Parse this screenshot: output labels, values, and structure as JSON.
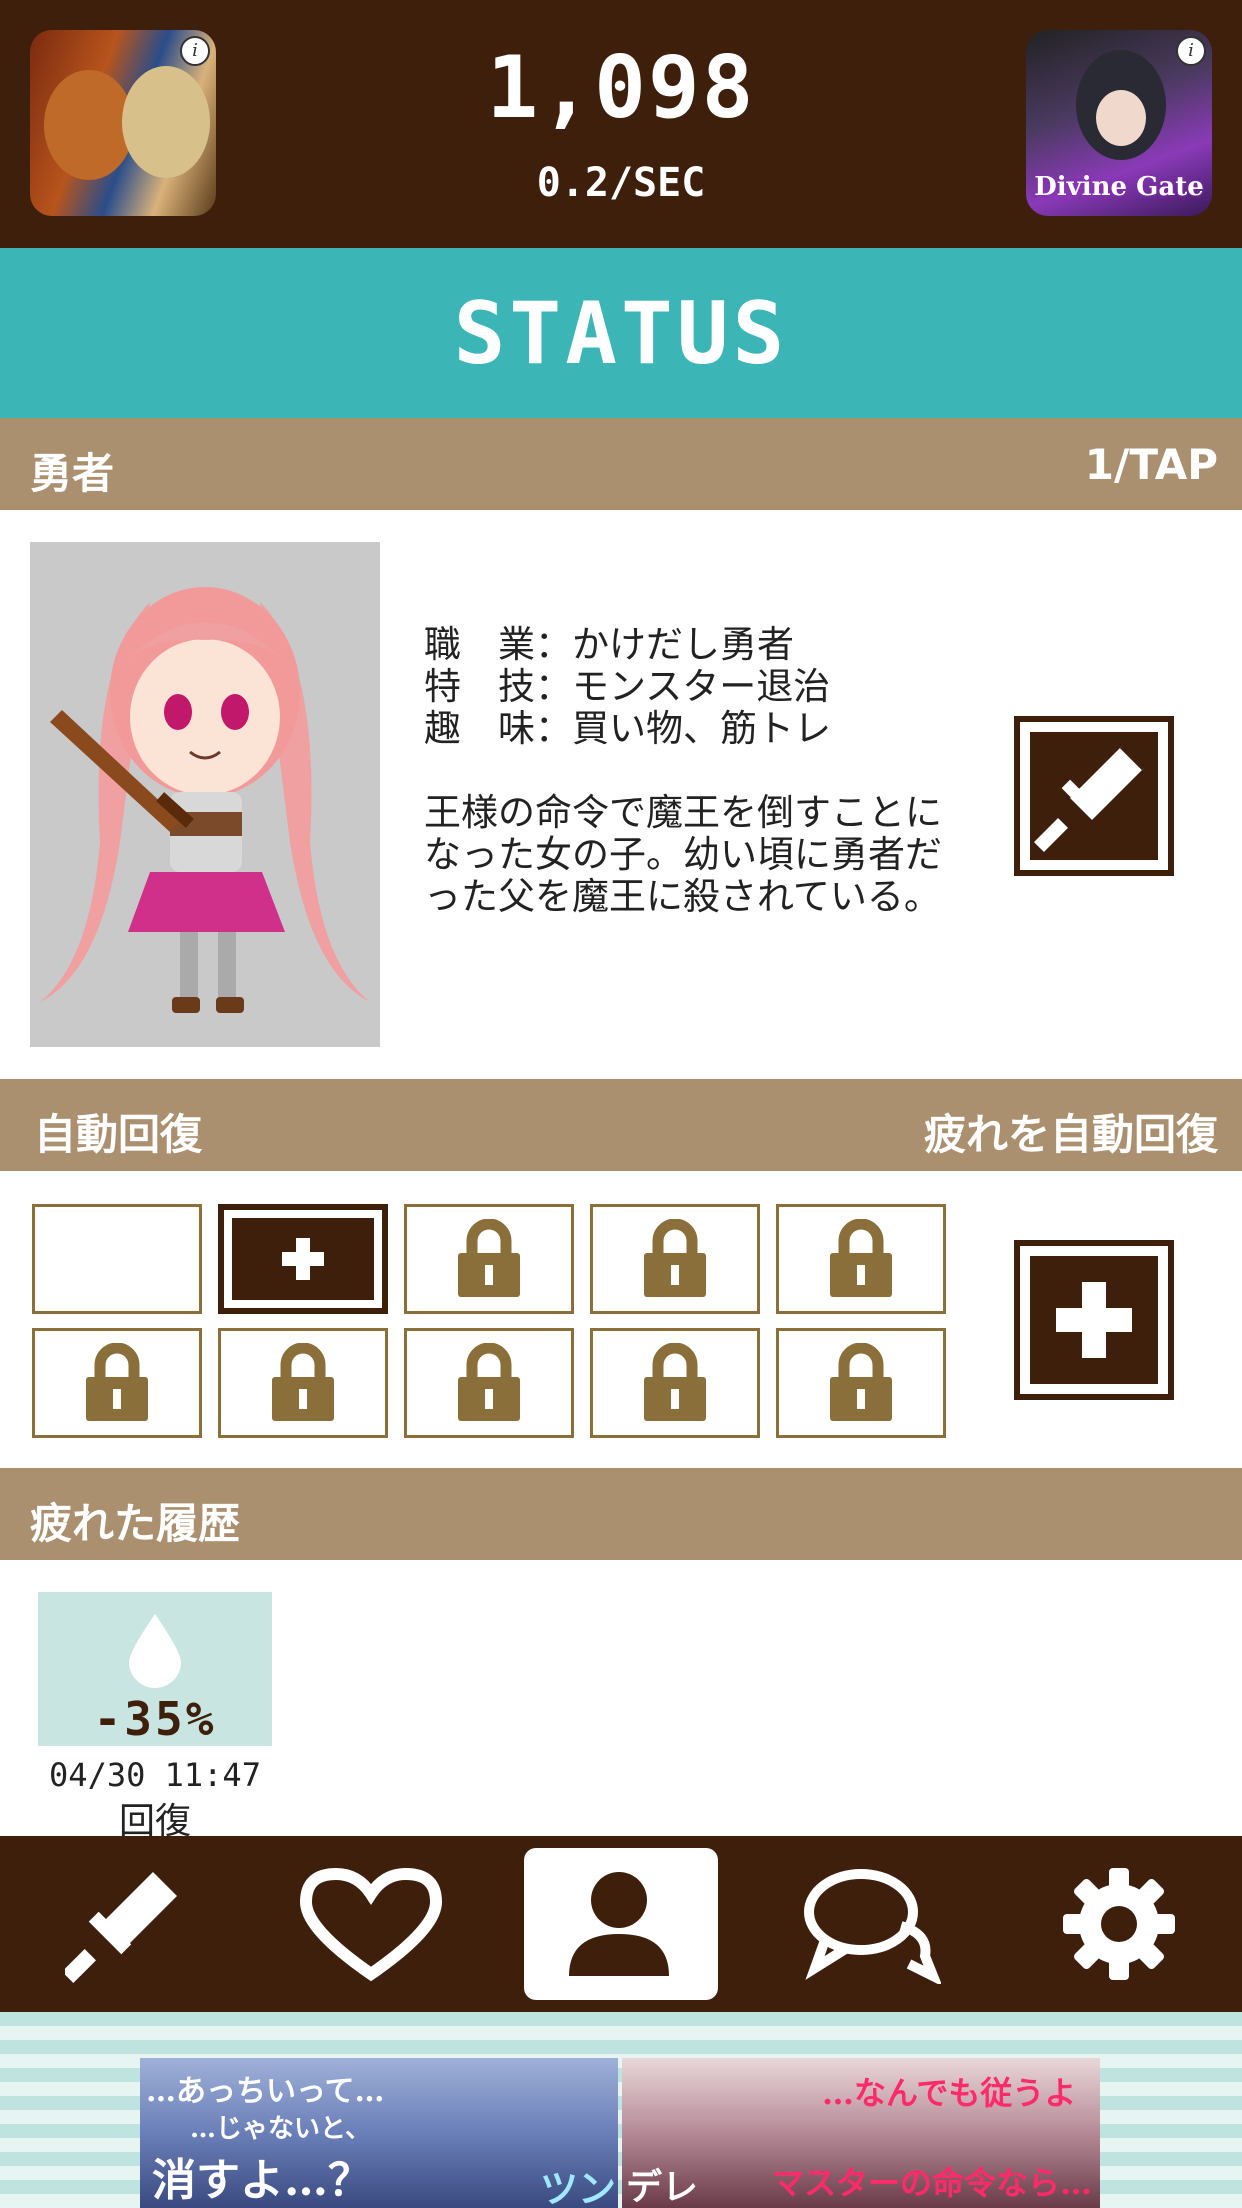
{
  "header": {
    "currency": "1,098",
    "rate": "0.2/SEC",
    "left_ad": {
      "label": "",
      "info": "i"
    },
    "right_ad": {
      "label": "Divine Gate",
      "info": "i"
    }
  },
  "page_title": "STATUS",
  "hero_section": {
    "title": "勇者",
    "right": "1/TAP",
    "profile": [
      {
        "key": "職　業",
        "value": "かけだし勇者"
      },
      {
        "key": "特　技",
        "value": "モンスター退治"
      },
      {
        "key": "趣　味",
        "value": "買い物、筋トレ"
      }
    ],
    "description": "王様の命令で魔王を倒すことになった女の子。幼い頃に勇者だった父を魔王に殺されている。",
    "action_icon": "sword-icon"
  },
  "auto_recovery": {
    "title": "自動回復",
    "right": "疲れを自動回復",
    "slots": [
      {
        "state": "empty"
      },
      {
        "state": "add"
      },
      {
        "state": "locked"
      },
      {
        "state": "locked"
      },
      {
        "state": "locked"
      },
      {
        "state": "locked"
      },
      {
        "state": "locked"
      },
      {
        "state": "locked"
      },
      {
        "state": "locked"
      },
      {
        "state": "locked"
      }
    ],
    "add_icon": "plus-icon"
  },
  "history": {
    "title": "疲れた履歴",
    "items": [
      {
        "percent": "-35%",
        "time": "04/30 11:47",
        "label": "回復",
        "icon": "droplet-icon"
      }
    ]
  },
  "nav": {
    "items": [
      {
        "name": "sword",
        "icon": "sword-icon",
        "active": false
      },
      {
        "name": "heart",
        "icon": "heart-icon",
        "active": false
      },
      {
        "name": "status",
        "icon": "user-icon",
        "active": true
      },
      {
        "name": "chat",
        "icon": "chat-icon",
        "active": false
      },
      {
        "name": "settings",
        "icon": "gear-icon",
        "active": false
      }
    ]
  },
  "banner": {
    "left_line1": "…あっちいって…",
    "left_line2": "…じゃないと、",
    "left_line3": "消すよ…？",
    "left_tag": "ツン",
    "right_line1": "…なんでも従うよ",
    "right_tag": "デレ",
    "right_line2": "マスターの命令なら…"
  },
  "colors": {
    "dark_brown": "#3d1f0c",
    "teal": "#3bb5b5",
    "tan": "#ab9070",
    "lock_gold": "#8b6f3a"
  }
}
